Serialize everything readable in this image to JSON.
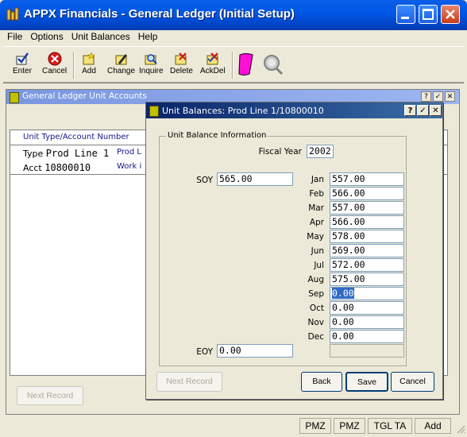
{
  "window": {
    "title": "APPX Financials - General Ledger (Initial Setup)"
  },
  "menu": [
    "File",
    "Options",
    "Unit Balances",
    "Help"
  ],
  "toolbar": [
    {
      "label": "Enter",
      "icon": "enter-icon"
    },
    {
      "label": "Cancel",
      "icon": "cancel-icon"
    },
    {
      "label": "Add",
      "icon": "add-icon"
    },
    {
      "label": "Change",
      "icon": "change-icon"
    },
    {
      "label": "Inquire",
      "icon": "inquire-icon"
    },
    {
      "label": "Delete",
      "icon": "delete-icon"
    },
    {
      "label": "AckDel",
      "icon": "ackdel-icon"
    }
  ],
  "bg_window": {
    "title": "General Ledger Unit Accounts",
    "header": "Unit Type/Account Number",
    "row": {
      "type_label": "Type",
      "type_value": "Prod Line 1",
      "acct_label": "Acct",
      "acct_value": "10800010",
      "col2_top": "Prod L",
      "col2_bottom": "Work i"
    },
    "next_record": "Next Record"
  },
  "dialog": {
    "title": "Unit Balances: Prod Line 1/10800010",
    "group": "Unit Balance Information",
    "fiscal_year_label": "Fiscal Year",
    "fiscal_year": "2002",
    "soy_label": "SOY",
    "soy": "565.00",
    "eoy_label": "EOY",
    "eoy": "0.00",
    "months": [
      {
        "m": "Jan",
        "v": "557.00"
      },
      {
        "m": "Feb",
        "v": "566.00"
      },
      {
        "m": "Mar",
        "v": "557.00"
      },
      {
        "m": "Apr",
        "v": "566.00"
      },
      {
        "m": "May",
        "v": "578.00"
      },
      {
        "m": "Jun",
        "v": "569.00"
      },
      {
        "m": "Jul",
        "v": "572.00"
      },
      {
        "m": "Aug",
        "v": "575.00"
      },
      {
        "m": "Sep",
        "v": "0.00"
      },
      {
        "m": "Oct",
        "v": "0.00"
      },
      {
        "m": "Nov",
        "v": "0.00"
      },
      {
        "m": "Dec",
        "v": "0.00"
      }
    ],
    "buttons": {
      "next_record": "Next Record",
      "back": "Back",
      "save": "Save",
      "cancel": "Cancel"
    }
  },
  "status": [
    "PMZ",
    "PMZ",
    "TGL TA",
    "Add"
  ],
  "colors": {
    "title_blue": "#0058e6",
    "selection": "#316ac5"
  }
}
